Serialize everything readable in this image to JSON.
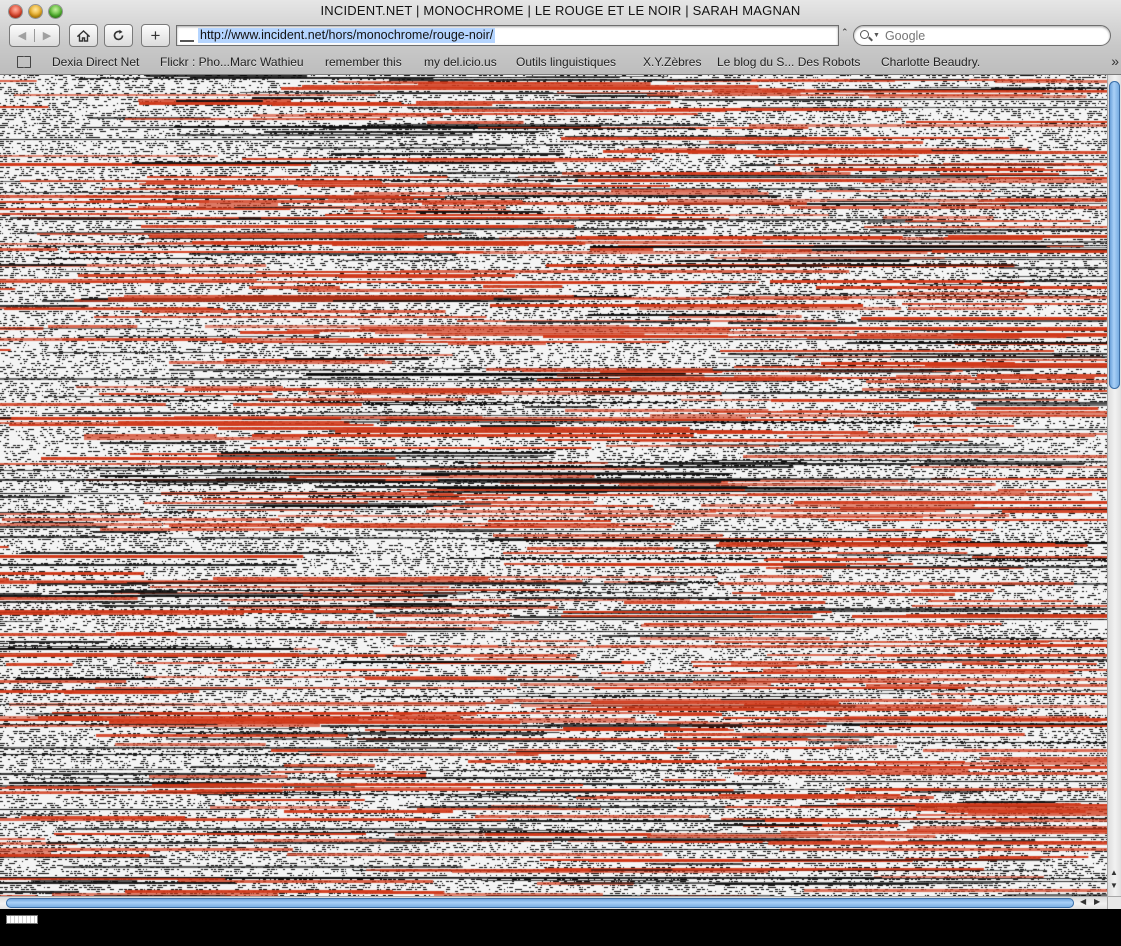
{
  "window": {
    "title": "INCIDENT.NET | MONOCHROME | LE ROUGE ET LE NOIR | SARAH MAGNAN"
  },
  "toolbar": {
    "back_icon": "back-arrow-icon",
    "forward_icon": "forward-arrow-icon",
    "home_icon": "home-icon",
    "reload_icon": "reload-icon",
    "add_bookmark_icon": "plus-icon",
    "url": "http://www.incident.net/hors/monochrome/rouge-noir/",
    "search_placeholder": "Google"
  },
  "bookmarks": {
    "items": [
      "Dexia Direct Net",
      "Flickr : Pho...Marc Wathieu",
      "remember this",
      "my del.icio.us",
      "Outils linguistiques",
      "X.Y.Zèbres",
      "Le blog du S... Des Robots",
      "Charlotte Beaudry."
    ],
    "overflow_label": "»"
  },
  "content": {
    "colors": {
      "red": "#d1391a",
      "black": "#0b0b0b",
      "paper": "#f4f4f4"
    }
  },
  "scrollbars": {
    "up_arrow": "▲",
    "down_arrow": "▼",
    "left_arrow": "◀",
    "right_arrow": "▶"
  }
}
